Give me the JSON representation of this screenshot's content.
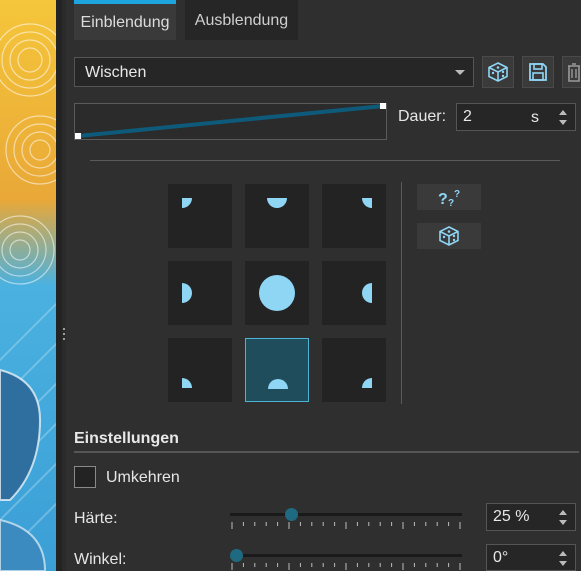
{
  "tabs": {
    "fade_in": "Einblendung",
    "fade_out": "Ausblendung"
  },
  "transition": {
    "selected": "Wischen"
  },
  "duration": {
    "label": "Dauer:",
    "value": "2",
    "unit": "s"
  },
  "direction_grid": {
    "selected_index": 7
  },
  "settings": {
    "title": "Einstellungen",
    "reverse_label": "Umkehren",
    "reverse_checked": false,
    "hardness": {
      "label": "Härte:",
      "value": "25 %",
      "fraction": 0.25
    },
    "angle": {
      "label": "Winkel:",
      "value": "0°",
      "fraction": 0.0
    }
  },
  "icons": {
    "toolbar": [
      "random-dice-icon",
      "save-icon",
      "delete-icon"
    ],
    "side": [
      "random-direction-icon",
      "dice-icon"
    ]
  },
  "colors": {
    "accent": "#1ea5e0",
    "shape": "#8fd6f5",
    "curve": "#0e5a7a",
    "selected_cell": "#1f4d5c"
  }
}
